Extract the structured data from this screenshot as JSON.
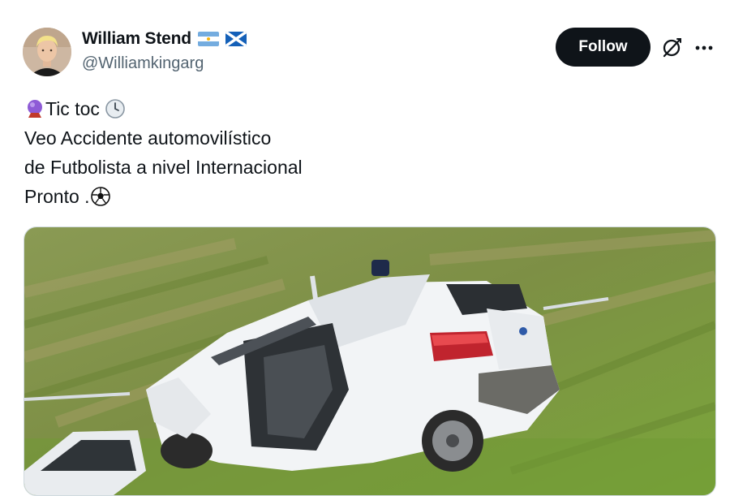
{
  "user": {
    "display_name": "William Stend",
    "handle": "@Williamkingarg",
    "avatar": "avatar-photo",
    "flags": [
      "argentina-flag",
      "scotland-flag"
    ]
  },
  "actions": {
    "follow_label": "Follow",
    "grok_icon": "grok-icon",
    "more_icon": "more-options-icon"
  },
  "tweet": {
    "lines": [
      {
        "prefix_icon": "crystal-ball-icon",
        "text": "Tic toc",
        "suffix_icon": "clock-icon"
      },
      {
        "text": "Veo Accidente automovilístico"
      },
      {
        "text": "de Futbolista a nivel Internacional"
      },
      {
        "text": "Pronto .",
        "suffix_icon": "soccer-ball-icon"
      }
    ]
  },
  "media": {
    "type": "photo",
    "subject": "wrecked white car in grass field"
  },
  "colors": {
    "follow_bg": "#0f1419",
    "secondary_text": "#536471",
    "media_border": "#cfd9de"
  }
}
